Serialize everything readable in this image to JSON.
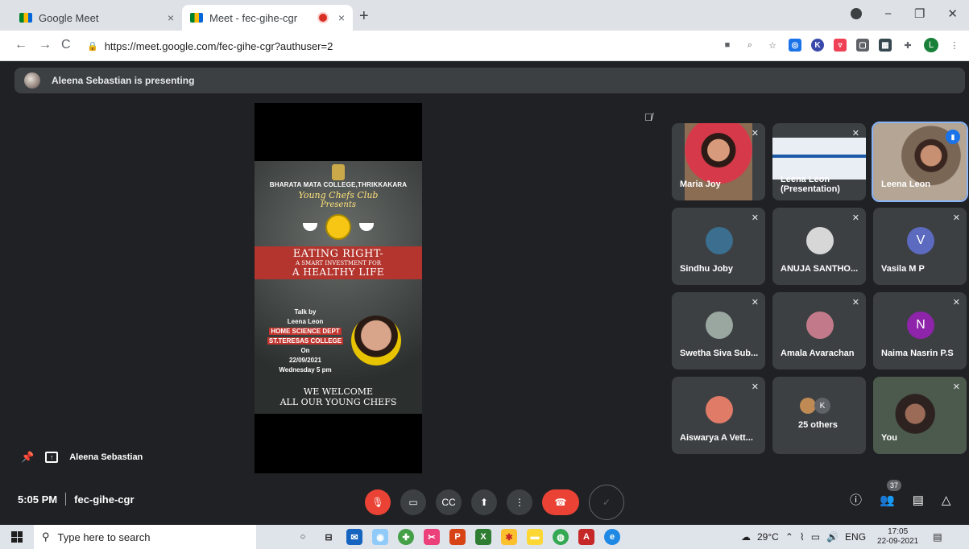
{
  "browser": {
    "tabs": [
      {
        "title": "Google Meet",
        "close": "×"
      },
      {
        "title": "Meet - fec-gihe-cgr",
        "close": "×"
      }
    ],
    "new_tab": "+",
    "window_controls": {
      "minimize": "−",
      "restore": "❐",
      "close": "✕"
    },
    "url": "https://meet.google.com/fec-gihe-cgr?authuser=2",
    "nav": {
      "back": "←",
      "forward": "→",
      "reload": "C"
    },
    "extensions": [
      "camera",
      "zoom",
      "star",
      "ext-a",
      "ext-k",
      "ext-pocket",
      "ext-box",
      "ext-grid",
      "puzzle"
    ],
    "profile_initial": "L"
  },
  "meet": {
    "presenting_banner": "Aleena Sebastian is presenting",
    "presenter_label": "Aleena Sebastian",
    "poster": {
      "college": "BHARATA MATA COLLEGE,THRIKKAKARA",
      "club": "Young Chefs Club",
      "presents": "Presents",
      "title1": "EATING RIGHT-",
      "title2": "A SMART INVESTMENT FOR",
      "title3": "A HEALTHY LIFE",
      "talk_lines": [
        "Talk by",
        "Leena Leon",
        "HOME SCIENCE DEPT",
        "ST.TERESAS COLLEGE",
        "On",
        "22/09/2021",
        "Wednesday 5 pm"
      ],
      "welcome1": "WE WELCOME",
      "welcome2": "ALL OUR YOUNG CHEFS"
    },
    "tiles": [
      {
        "name": "Maria Joy",
        "kind": "video"
      },
      {
        "name": "Leena Leon\n(Presentation)",
        "kind": "presentation"
      },
      {
        "name": "Leena Leon",
        "kind": "video-active"
      },
      {
        "name": "Sindhu Joby",
        "kind": "avatar",
        "color": "#3b6e8f"
      },
      {
        "name": "ANUJA SANTHO...",
        "kind": "avatar",
        "color": "#d7d7d7"
      },
      {
        "name": "Vasila M P",
        "kind": "letter",
        "letter": "V",
        "color": "#5c6bc0"
      },
      {
        "name": "Swetha Siva Sub...",
        "kind": "avatar",
        "color": "#9aa6a0"
      },
      {
        "name": "Amala Avarachan",
        "kind": "avatar",
        "color": "#c27a8a"
      },
      {
        "name": "Naima Nasrin P.S",
        "kind": "letter",
        "letter": "N",
        "color": "#8e24aa"
      },
      {
        "name": "Aiswarya A Vett...",
        "kind": "avatar",
        "color": "#e07b67"
      },
      {
        "name": "25 others",
        "kind": "others",
        "letter": "K"
      },
      {
        "name": "You",
        "kind": "video-self"
      }
    ],
    "time": "5:05 PM",
    "meeting_code": "fec-gihe-cgr",
    "participants_count": "37"
  },
  "taskbar": {
    "search_placeholder": "Type here to search",
    "weather": "29°C",
    "lang": "ENG",
    "time": "17:05",
    "date": "22-09-2021"
  }
}
